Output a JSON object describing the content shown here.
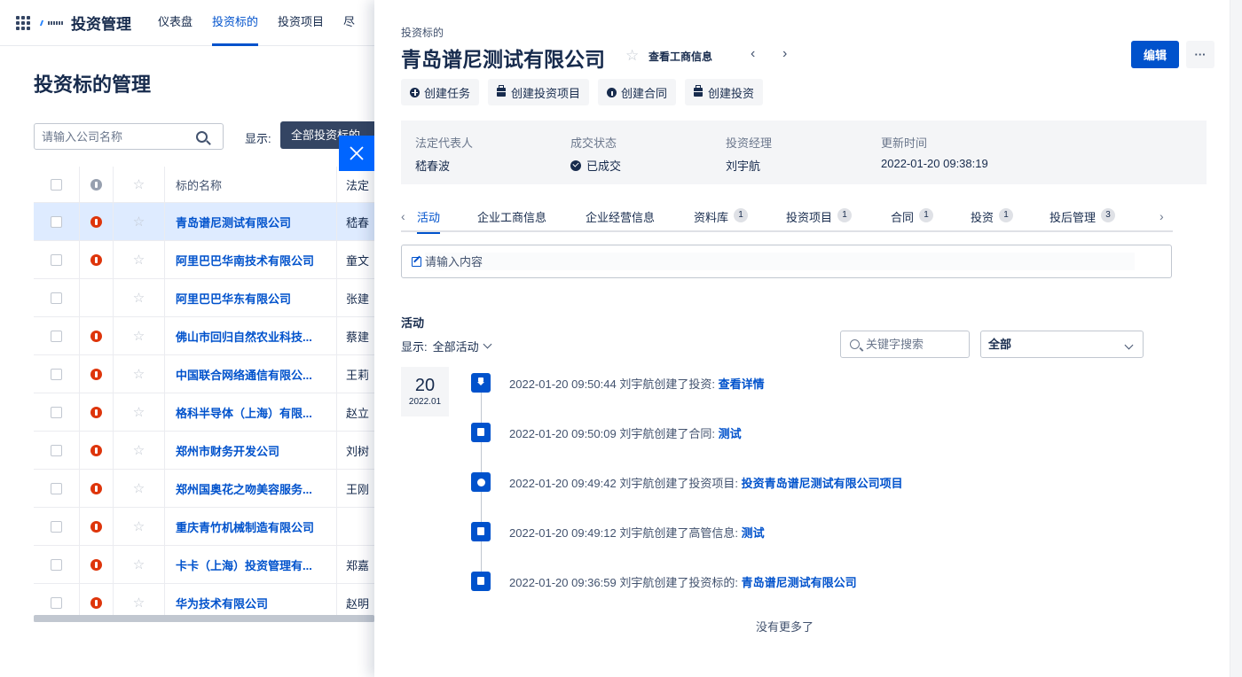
{
  "topbar": {
    "app_title": "投资管理",
    "nav": [
      "仪表盘",
      "投资标的",
      "投资项目",
      "尽"
    ]
  },
  "list_page": {
    "title": "投资标的管理",
    "search_placeholder": "请输入公司名称",
    "display_label": "显示:",
    "display_value": "全部投资标的",
    "columns": {
      "name": "标的名称",
      "rep": "法定"
    },
    "rows": [
      {
        "name": "青岛谱尼测试有限公司",
        "rep": "嵇春",
        "badge": true
      },
      {
        "name": "阿里巴巴华南技术有限公司",
        "rep": "童文",
        "badge": true
      },
      {
        "name": "阿里巴巴华东有限公司",
        "rep": "张建",
        "badge": false
      },
      {
        "name": "佛山市回归自然农业科技...",
        "rep": "蔡建",
        "badge": true
      },
      {
        "name": "中国联合网络通信有限公...",
        "rep": "王莉",
        "badge": true
      },
      {
        "name": "格科半导体（上海）有限...",
        "rep": "赵立",
        "badge": true
      },
      {
        "name": "郑州市财务开发公司",
        "rep": "刘树",
        "badge": true
      },
      {
        "name": "郑州国奥花之吻美容服务...",
        "rep": "王刚",
        "badge": true
      },
      {
        "name": "重庆青竹机械制造有限公司",
        "rep": "",
        "badge": true
      },
      {
        "name": "卡卡（上海）投资管理有...",
        "rep": "郑嘉",
        "badge": true
      },
      {
        "name": "华为技术有限公司",
        "rep": "赵明",
        "badge": true
      }
    ]
  },
  "drawer": {
    "breadcrumb": "投资标的",
    "title": "青岛谱尼测试有限公司",
    "biz_info_link": "查看工商信息",
    "prev": "‹",
    "next": "›",
    "edit_label": "编辑",
    "more_label": "···",
    "actions": {
      "create_task": "创建任务",
      "create_project": "创建投资项目",
      "create_contract": "创建合同",
      "create_investment": "创建投资"
    },
    "info": {
      "legal_rep_label": "法定代表人",
      "legal_rep_value": "嵇春波",
      "deal_status_label": "成交状态",
      "deal_status_value": "已成交",
      "manager_label": "投资经理",
      "manager_value": "刘宇航",
      "updated_label": "更新时间",
      "updated_value": "2022-01-20 09:38:19"
    },
    "tabs": [
      {
        "label": "活动",
        "count": ""
      },
      {
        "label": "企业工商信息",
        "count": ""
      },
      {
        "label": "企业经营信息",
        "count": ""
      },
      {
        "label": "资料库",
        "count": "1"
      },
      {
        "label": "投资项目",
        "count": "1"
      },
      {
        "label": "合同",
        "count": "1"
      },
      {
        "label": "投资",
        "count": "1"
      },
      {
        "label": "投后管理",
        "count": "3"
      }
    ],
    "tab_left": "‹",
    "tab_right": "›",
    "compose_placeholder": "请输入内容",
    "activity": {
      "heading": "活动",
      "filter_label": "显示:",
      "filter_value": "全部活动",
      "keyword_placeholder": "关键字搜索",
      "type_value": "全部",
      "date_day": "20",
      "date_month": "2022.01",
      "items": [
        {
          "text": "2022-01-20 09:50:44 刘宇航创建了投资:",
          "link": "查看详情",
          "icon": "download-icon"
        },
        {
          "text": "2022-01-20 09:50:09 刘宇航创建了合同:",
          "link": "测试",
          "icon": "contract-icon"
        },
        {
          "text": "2022-01-20 09:49:42 刘宇航创建了投资项目:",
          "link": "投资青岛谱尼测试有限公司项目",
          "icon": "coin-icon"
        },
        {
          "text": "2022-01-20 09:49:12 刘宇航创建了高管信息:",
          "link": "测试",
          "icon": "contact-icon"
        },
        {
          "text": "2022-01-20 09:36:59 刘宇航创建了投资标的:",
          "link": "青岛谱尼测试有限公司",
          "icon": "building-icon"
        }
      ],
      "no_more": "没有更多了"
    }
  },
  "colors": {
    "primary": "#0052cc",
    "close_button": "#0065ff",
    "badge_red": "#de350b",
    "selected_row": "#deebff"
  }
}
